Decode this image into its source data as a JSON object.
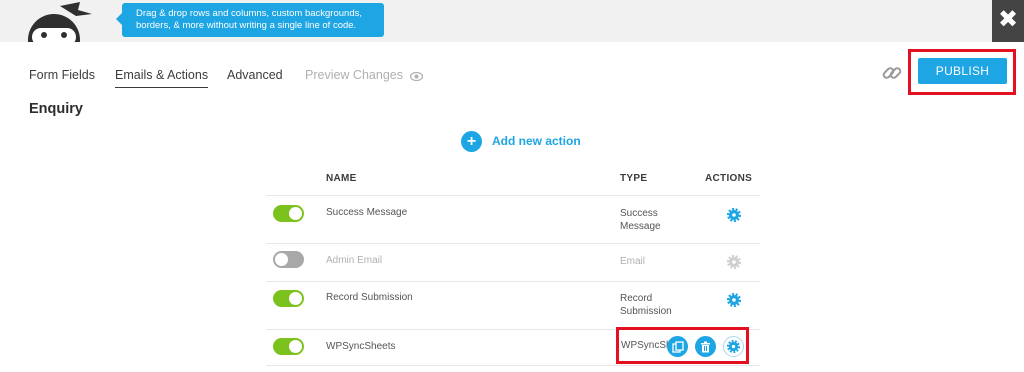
{
  "tooltip": {
    "line1": "Drag & drop rows and columns, custom backgrounds,",
    "line2": "borders, & more without writing a single line of code."
  },
  "tabs": [
    {
      "label": "Form Fields"
    },
    {
      "label": "Emails & Actions"
    },
    {
      "label": "Advanced"
    },
    {
      "label": "Preview Changes"
    }
  ],
  "header": {
    "publish_label": "PUBLISH"
  },
  "form": {
    "title": "Enquiry"
  },
  "actions": {
    "add_label": "Add new action",
    "columns": {
      "name": "NAME",
      "type": "TYPE",
      "actions": "ACTIONS"
    },
    "rows": [
      {
        "name": "Success Message",
        "type": "Success Message",
        "enabled": true
      },
      {
        "name": "Admin Email",
        "type": "Email",
        "enabled": false
      },
      {
        "name": "Record Submission",
        "type": "Record Submission",
        "enabled": true
      },
      {
        "name": "WPSyncSheets",
        "type": "WPSyncSheets",
        "enabled": true
      }
    ]
  },
  "colors": {
    "accent": "#1ea5e3",
    "toggle_on": "#7cc21e",
    "highlight": "#e3111f"
  }
}
